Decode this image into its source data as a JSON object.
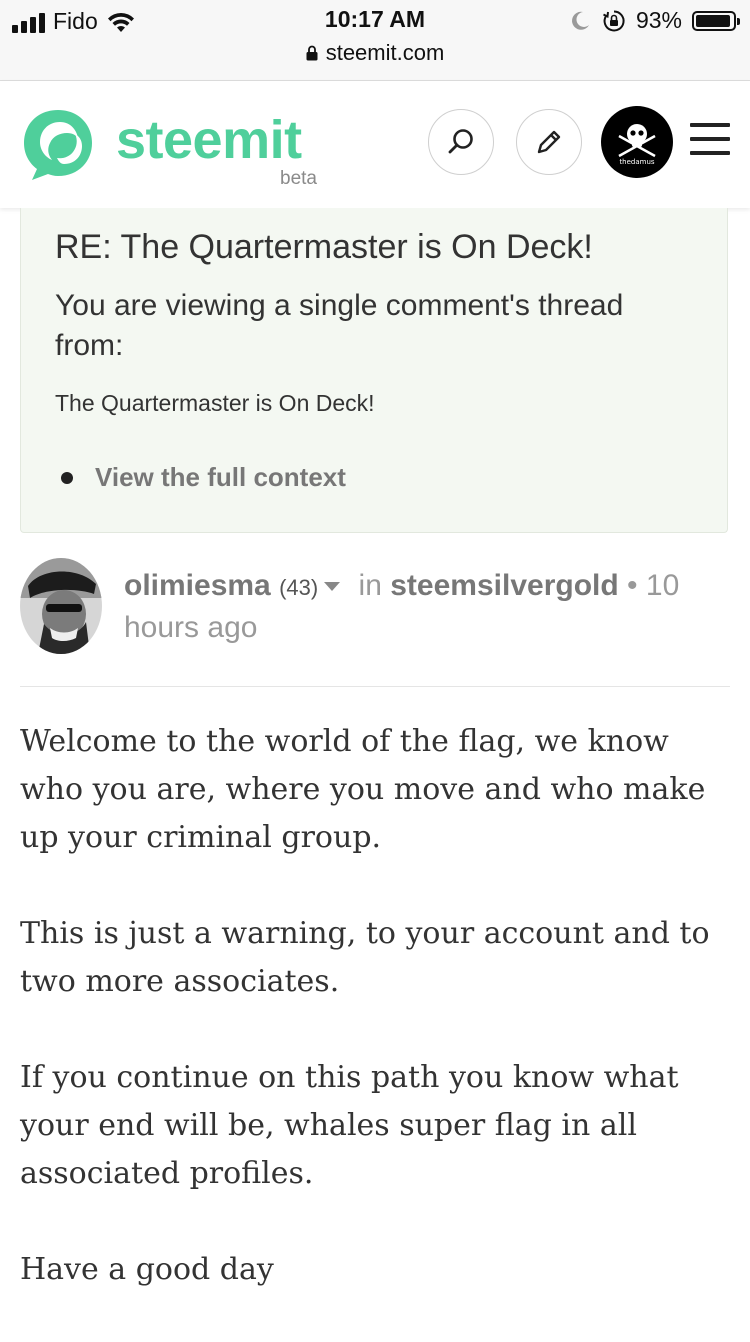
{
  "status_bar": {
    "carrier": "Fido",
    "time": "10:17 AM",
    "battery_percent": "93%",
    "battery_level": 0.93,
    "url": "steemit.com"
  },
  "header": {
    "brand": "steemit",
    "beta": "beta",
    "brand_color": "#4fcf9b",
    "avatar_text": "thedamus"
  },
  "context": {
    "title": "RE: The Quartermaster is On Deck!",
    "subtitle": "You are viewing a single comment's thread from:",
    "parent_link": "The Quartermaster is On Deck!",
    "full_context_link": "View the full context"
  },
  "author": {
    "username": "olimiesma",
    "reputation": "(43)",
    "in_label": "in",
    "category": "steemsilvergold",
    "separator": "•",
    "timestamp": "10 hours ago"
  },
  "comment": {
    "paragraphs": [
      "Welcome to the world of the flag, we know who you are, where you move and who make up your criminal group.",
      "This is just a warning, to your account and to two more associates.",
      "If you continue on this path you know what your end will be, whales super flag in all associated profiles.",
      "Have a good day"
    ]
  }
}
